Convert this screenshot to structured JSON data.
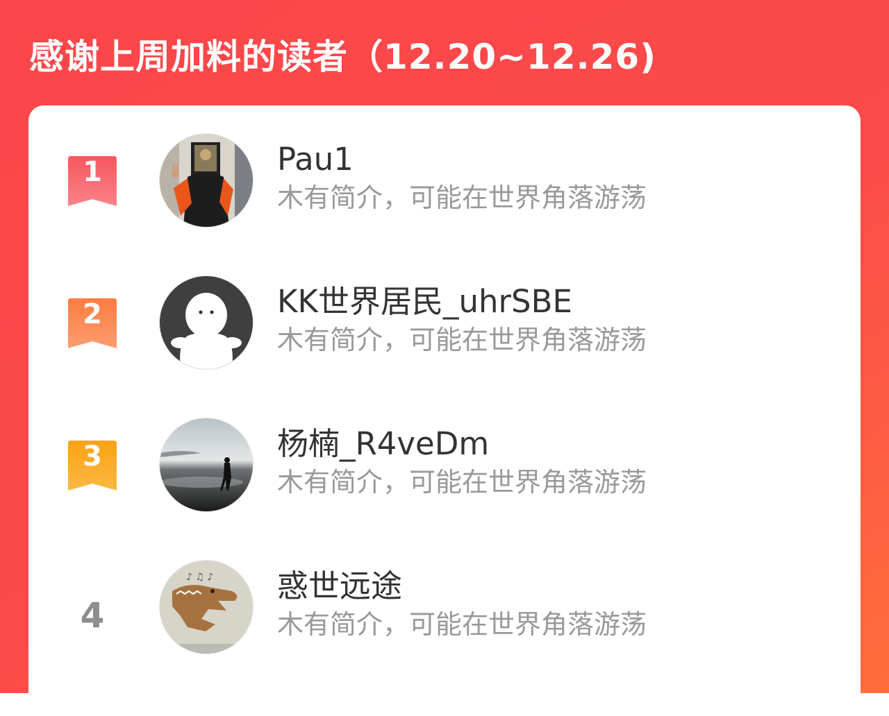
{
  "header": {
    "title": "感谢上周加料的读者（12.20~12.26)"
  },
  "colors": {
    "rank1": "#f8646d",
    "rank2": "#fc8a50",
    "rank3": "#fbaa20",
    "rank_plain": "#8e8e8e"
  },
  "readers": [
    {
      "rank": "1",
      "name": "Pau1",
      "bio": "木有简介，可能在世界角落游荡",
      "avatar": "person-poster-photo"
    },
    {
      "rank": "2",
      "name": "KK世界居民_uhrSBE",
      "bio": "木有简介，可能在世界角落游荡",
      "avatar": "default-ghost-avatar"
    },
    {
      "rank": "3",
      "name": "杨楠_R4veDm",
      "bio": "木有简介，可能在世界角落游荡",
      "avatar": "beach-silhouette-photo"
    },
    {
      "rank": "4",
      "name": "惑世远途",
      "bio": "木有简介，可能在世界角落游荡",
      "avatar": "crocodile-drawing"
    }
  ]
}
